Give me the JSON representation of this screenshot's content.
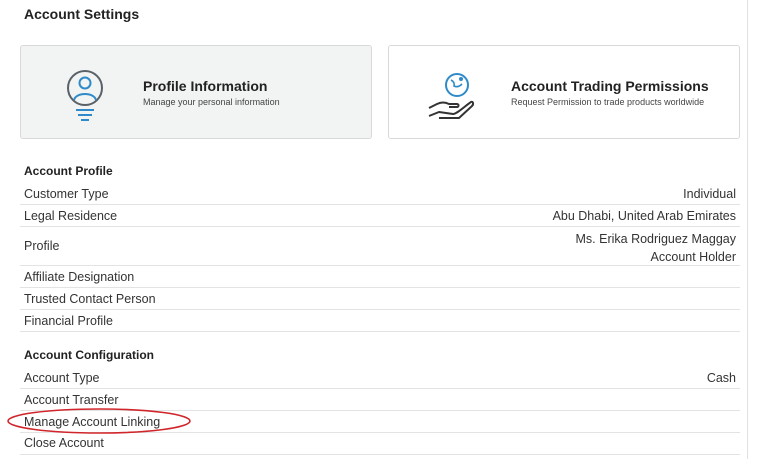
{
  "page": {
    "title": "Account Settings"
  },
  "cards": [
    {
      "title": "Profile Information",
      "subtitle": "Manage your personal information",
      "icon": "user-profile-icon"
    },
    {
      "title": "Account Trading Permissions",
      "subtitle": "Request Permission to trade products worldwide",
      "icon": "globe-hand-icon"
    }
  ],
  "account_profile": {
    "title": "Account Profile",
    "rows": [
      {
        "label": "Customer Type",
        "value": "Individual"
      },
      {
        "label": "Legal Residence",
        "value": "Abu Dhabi, United Arab Emirates"
      },
      {
        "label": "Profile",
        "value_line1": "Ms. Erika Rodriguez Maggay",
        "value_line2": "Account Holder"
      },
      {
        "label": "Affiliate Designation",
        "value": ""
      },
      {
        "label": "Trusted Contact Person",
        "value": ""
      },
      {
        "label": "Financial Profile",
        "value": ""
      }
    ]
  },
  "account_configuration": {
    "title": "Account Configuration",
    "rows": [
      {
        "label": "Account Type",
        "value": "Cash"
      },
      {
        "label": "Account Transfer",
        "value": ""
      },
      {
        "label": "Manage Account Linking",
        "value": ""
      },
      {
        "label": "Close Account",
        "value": ""
      }
    ]
  },
  "colors": {
    "icon_gray": "#5a6268",
    "icon_blue": "#2f8ac9",
    "highlight_ellipse": "#d0262b",
    "selected_card_bg": "#f2f3f3"
  }
}
